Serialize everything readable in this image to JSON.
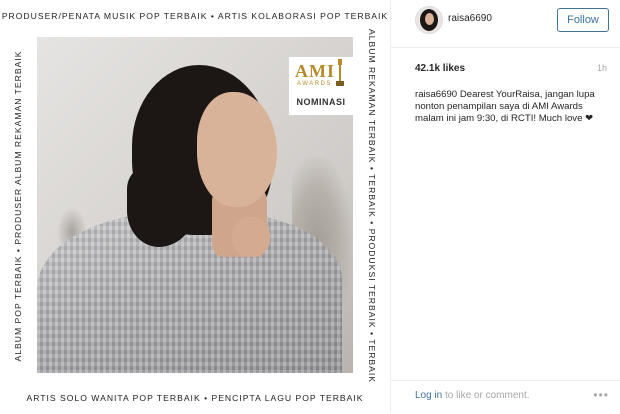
{
  "media": {
    "border_top": "PRODUSER/PENATA MUSIK POP TERBAIK • ARTIS KOLABORASI POP TERBAIK",
    "border_bottom": "ARTIS SOLO WANITA POP TERBAIK • PENCIPTA LAGU POP TERBAIK",
    "border_left": "ALBUM POP TERBAIK • PRODUSER ALBUM REKAMAN TERBAIK",
    "border_right": "ALBUM REKAMAN TERBAIK • TERBAIK • PRODUKSI TERBAIK • TERBAIK",
    "badge": {
      "logo": "AMI",
      "sub": "AWARDS",
      "label": "NOMINASI"
    }
  },
  "header": {
    "username": "raisa6690",
    "follow_label": "Follow"
  },
  "stats": {
    "likes": "42.1k likes",
    "time": "1h"
  },
  "caption": {
    "username": "raisa6690",
    "text": "Dearest YourRaisa, jangan lupa nonton penampilan saya di AMI Awards malam ini jam 9:30, di RCTI! Much love ❤"
  },
  "footer": {
    "login_link": "Log in",
    "login_rest": " to like or comment.",
    "more": "•••"
  },
  "colors": {
    "link": "#3f729b",
    "muted": "#a5a7aa",
    "gold": "#b48a2c"
  }
}
